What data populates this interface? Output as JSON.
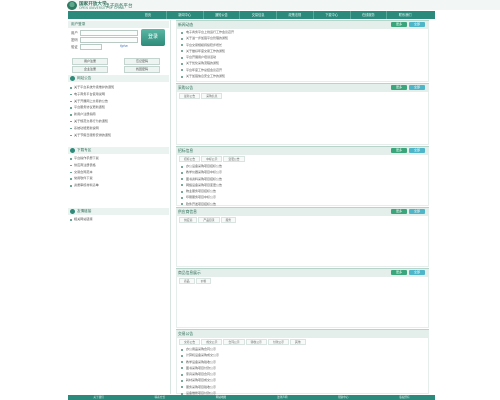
{
  "header": {
    "logo_name": "国家开放大学",
    "logo_sub": "OPEN UNIVERSITY OF CHINA",
    "site_title": "电子商务平台"
  },
  "nav": [
    "首页",
    "新闻中心",
    "通知公告",
    "交易信息",
    "政策法规",
    "下载中心",
    "在线服务",
    "联系我们"
  ],
  "login": {
    "title": "用户登录",
    "user_label": "用户",
    "pass_label": "密码",
    "code_label": "验证",
    "code_hint": "fgha",
    "submit": "登录",
    "btn1": "用户注册",
    "btn2": "忘记密码",
    "btn3": "企业注册",
    "btn4": "找回密码"
  },
  "sections": {
    "s1": {
      "title": "网站公告",
      "items": [
        "关于平台系统升级维护的通知",
        "电子商务平台使用说明",
        "关于开展网上交易的公告",
        "平台服务协议更新通知",
        "新用户注册指南",
        "关于规范交易行为的通知",
        "系统功能更新说明",
        "关于节假日服务安排的通知"
      ]
    },
    "s2": {
      "title": "下载专区",
      "items": [
        "平台操作手册下载",
        "供应商注册表格",
        "交易合同范本",
        "常用软件下载",
        "资质审核材料清单"
      ]
    },
    "s3": {
      "title": "友情链接",
      "items": [
        "相关网站链接"
      ]
    }
  },
  "panels": [
    {
      "title": "新闻动态",
      "tag1": "更多",
      "tag2": "全部",
      "tabs": [],
      "rows": [
        "电子商务平台上线运行工作会议召开",
        "关于进一步加强平台管理的通知",
        "平台交易规模持续稳步增长",
        "关于做好年度交易工作的通知",
        "平台开展用户培训活动",
        "关于优化采购流程的通知",
        "平台年度工作总结会议召开",
        "关于加强信息安全工作的通知"
      ]
    },
    {
      "title": "采购公告",
      "tag1": "更多",
      "tag2": "全部",
      "tabs": [
        "最新公告",
        "采购信息"
      ],
      "rows": []
    },
    {
      "title": "招标信息",
      "tag1": "更多",
      "tag2": "全部",
      "tabs": [
        "招标公告",
        "中标公示",
        "变更公告"
      ],
      "rows": [
        "办公设备采购项目招标公告",
        "教学仪器采购项目中标公示",
        "图书资料采购项目招标公告",
        "网络设备采购项目变更公告",
        "物业服务项目招标公告",
        "印刷服务项目中标公示",
        "软件开发项目招标公告"
      ]
    },
    {
      "title": "供应商信息",
      "tag1": "更多",
      "tag2": "全部",
      "tabs": [
        "供应商",
        "产品目录",
        "服务"
      ],
      "rows": []
    },
    {
      "title": "商品信息展示",
      "tag1": "更多",
      "tag2": "全部",
      "tabs": [
        "商品",
        "价格"
      ],
      "rows": []
    },
    {
      "title": "交易公告",
      "tag1": "",
      "tag2": "",
      "tabs": [
        "交易公告",
        "成交公示",
        "合同公示",
        "验收公示",
        "付款公示",
        "其他"
      ],
      "rows": [
        "办公用品采购合同公示",
        "计算机设备采购成交公示",
        "教学设备采购验收公示",
        "图书采购项目付款公示",
        "家具采购项目合同公示",
        "耗材采购项目成交公示",
        "服务采购项目验收公示",
        "设备维修项目付款公示"
      ]
    }
  ],
  "footer": [
    "关于我们",
    "联系方式",
    "网站地图",
    "法律声明",
    "帮助中心",
    "版权所有"
  ]
}
